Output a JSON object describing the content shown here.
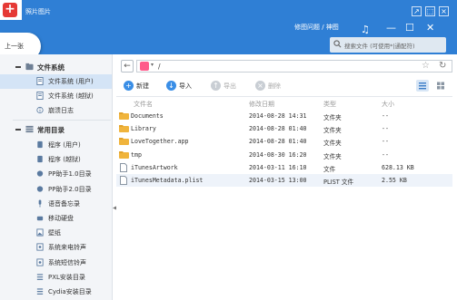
{
  "window": {
    "title": "照片图片",
    "breadcrumb": "修图问题 / 神图",
    "search_placeholder": "搜索文件 (可使用*|通配符)",
    "back_label": "上一张"
  },
  "sidebar": {
    "groups": [
      {
        "label": "文件系统",
        "items": [
          {
            "label": "文件系统 (用户)",
            "icon": "folder-icon",
            "selected": true
          },
          {
            "label": "文件系统 (越狱)",
            "icon": "folder-icon",
            "selected": false
          },
          {
            "label": "崩溃日志",
            "icon": "info-icon",
            "selected": false
          }
        ]
      },
      {
        "label": "常用目录",
        "items": [
          {
            "label": "程序 (用户)",
            "icon": "app-icon"
          },
          {
            "label": "程序 (越狱)",
            "icon": "app-icon"
          },
          {
            "label": "PP助手1.0目录",
            "icon": "pp-icon"
          },
          {
            "label": "PP助手2.0目录",
            "icon": "pp-icon"
          },
          {
            "label": "语音备忘录",
            "icon": "mic-icon"
          },
          {
            "label": "移动硬盘",
            "icon": "disk-icon"
          },
          {
            "label": "壁纸",
            "icon": "wallpaper-icon"
          },
          {
            "label": "系统来电铃声",
            "icon": "ringtone-icon"
          },
          {
            "label": "系统短信铃声",
            "icon": "sms-tone-icon"
          },
          {
            "label": "PXL安装目录",
            "icon": "list-icon"
          },
          {
            "label": "Cydia安装目录",
            "icon": "list-icon"
          }
        ]
      }
    ]
  },
  "addressbar": {
    "path": "/"
  },
  "toolbar": {
    "new_label": "新建",
    "import_label": "导入",
    "export_label": "导出",
    "delete_label": "删除"
  },
  "filelist": {
    "columns": [
      "文件名",
      "修改日期",
      "类型",
      "大小"
    ],
    "rows": [
      {
        "name": "Documents",
        "date": "2014-08-28 14:31",
        "type": "文件夹",
        "size": "--",
        "kind": "folder"
      },
      {
        "name": "Library",
        "date": "2014-08-28 01:40",
        "type": "文件夹",
        "size": "--",
        "kind": "folder"
      },
      {
        "name": "LoveTogether.app",
        "date": "2014-08-28 01:40",
        "type": "文件夹",
        "size": "--",
        "kind": "folder"
      },
      {
        "name": "tmp",
        "date": "2014-08-30 16:20",
        "type": "文件夹",
        "size": "--",
        "kind": "folder"
      },
      {
        "name": "iTunesArtwork",
        "date": "2014-03-11 16:10",
        "type": "文件",
        "size": "628.13 KB",
        "kind": "file"
      },
      {
        "name": "iTunesMetadata.plist",
        "date": "2014-03-15 13:00",
        "type": "PLIST 文件",
        "size": "2.55 KB",
        "kind": "file"
      }
    ]
  },
  "colors": {
    "titlebar": "#2f7fd5",
    "accent": "#3a8ee6",
    "folder": "#f0b43c",
    "sidebar_selected": "#d4e4f6"
  }
}
